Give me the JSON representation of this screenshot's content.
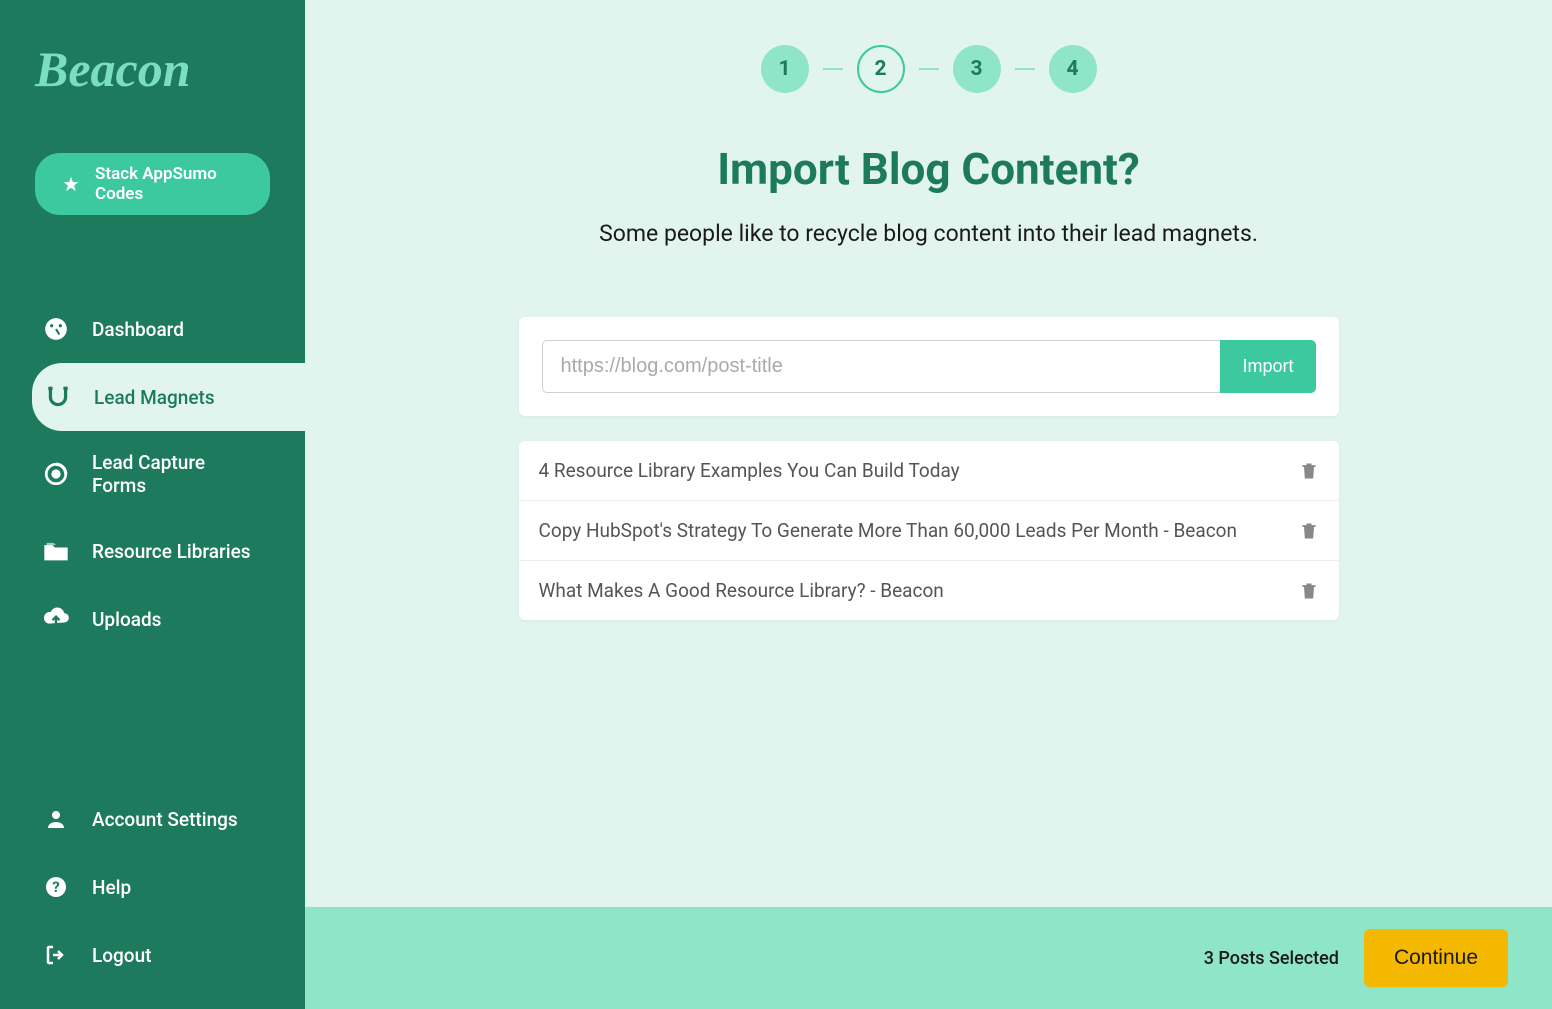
{
  "brand": "Beacon",
  "promo": {
    "label": "Stack AppSumo Codes"
  },
  "sidebar": {
    "items": [
      {
        "label": "Dashboard",
        "icon": "dashboard"
      },
      {
        "label": "Lead Magnets",
        "icon": "magnet"
      },
      {
        "label": "Lead Capture Forms",
        "icon": "target"
      },
      {
        "label": "Resource Libraries",
        "icon": "folder"
      },
      {
        "label": "Uploads",
        "icon": "cloud-upload"
      }
    ],
    "bottom": [
      {
        "label": "Account Settings",
        "icon": "user"
      },
      {
        "label": "Help",
        "icon": "question"
      },
      {
        "label": "Logout",
        "icon": "logout"
      }
    ]
  },
  "steps": [
    "1",
    "2",
    "3",
    "4"
  ],
  "current_step": 2,
  "page": {
    "title": "Import Blog Content?",
    "subtitle": "Some people like to recycle blog content into their lead magnets."
  },
  "import": {
    "placeholder": "https://blog.com/post-title",
    "button": "Import"
  },
  "posts": [
    {
      "title": "4 Resource Library Examples You Can Build Today"
    },
    {
      "title": "Copy HubSpot's Strategy To Generate More Than 60,000 Leads Per Month - Beacon"
    },
    {
      "title": "What Makes A Good Resource Library? - Beacon"
    }
  ],
  "footer": {
    "selected": "3 Posts Selected",
    "continue": "Continue"
  }
}
